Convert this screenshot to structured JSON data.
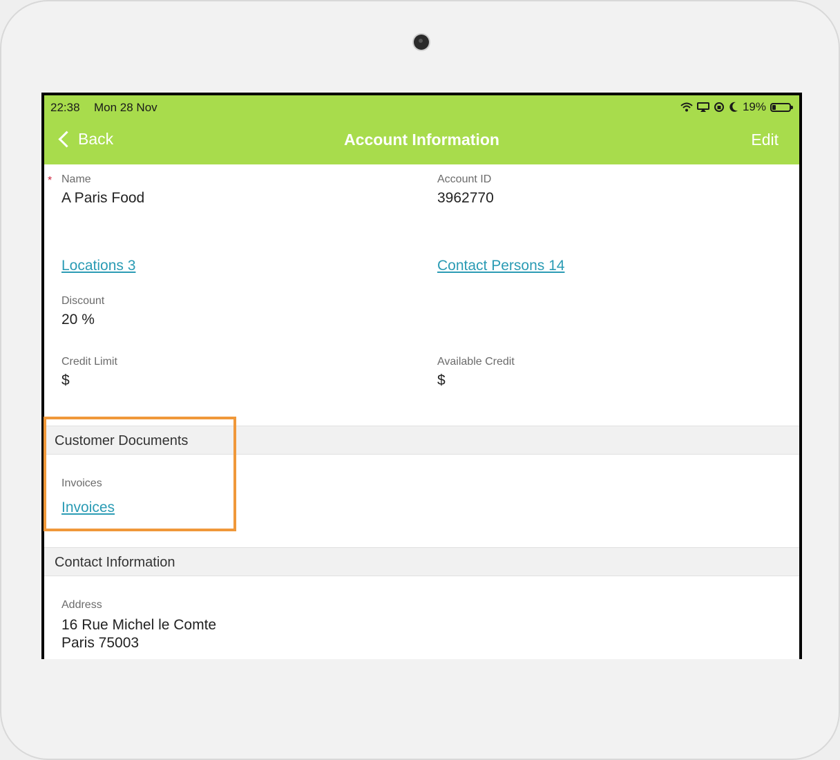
{
  "status": {
    "time": "22:38",
    "date": "Mon 28 Nov",
    "battery": "19%",
    "battery_level": 0.19,
    "icons": [
      "wifi-icon",
      "airplay-icon",
      "orientation-lock-icon",
      "moon-icon",
      "battery-icon"
    ]
  },
  "nav": {
    "back_label": "Back",
    "title": "Account Information",
    "edit_label": "Edit"
  },
  "required_marker": "*",
  "fields": {
    "name": {
      "label": "Name",
      "value": "A Paris Food"
    },
    "account_id": {
      "label": "Account ID",
      "value": "3962770"
    },
    "locations": "Locations 3",
    "contact_persons": "Contact Persons 14",
    "discount": {
      "label": "Discount",
      "value": "20 %"
    },
    "credit_limit": {
      "label": "Credit Limit",
      "value": "$"
    },
    "available_credit": {
      "label": "Available Credit",
      "value": "$"
    }
  },
  "customer_documents": {
    "title": "Customer Documents",
    "invoices_label": "Invoices",
    "invoices_link": "Invoices"
  },
  "contact_information": {
    "title": "Contact Information",
    "address_label": "Address",
    "address_line1": "16 Rue Michel le Comte",
    "address_line2": "Paris 75003"
  },
  "colors": {
    "header": "#a8dc4c",
    "link": "#2a9bb4",
    "highlight": "#f0983a",
    "required": "#cc1f3a"
  }
}
